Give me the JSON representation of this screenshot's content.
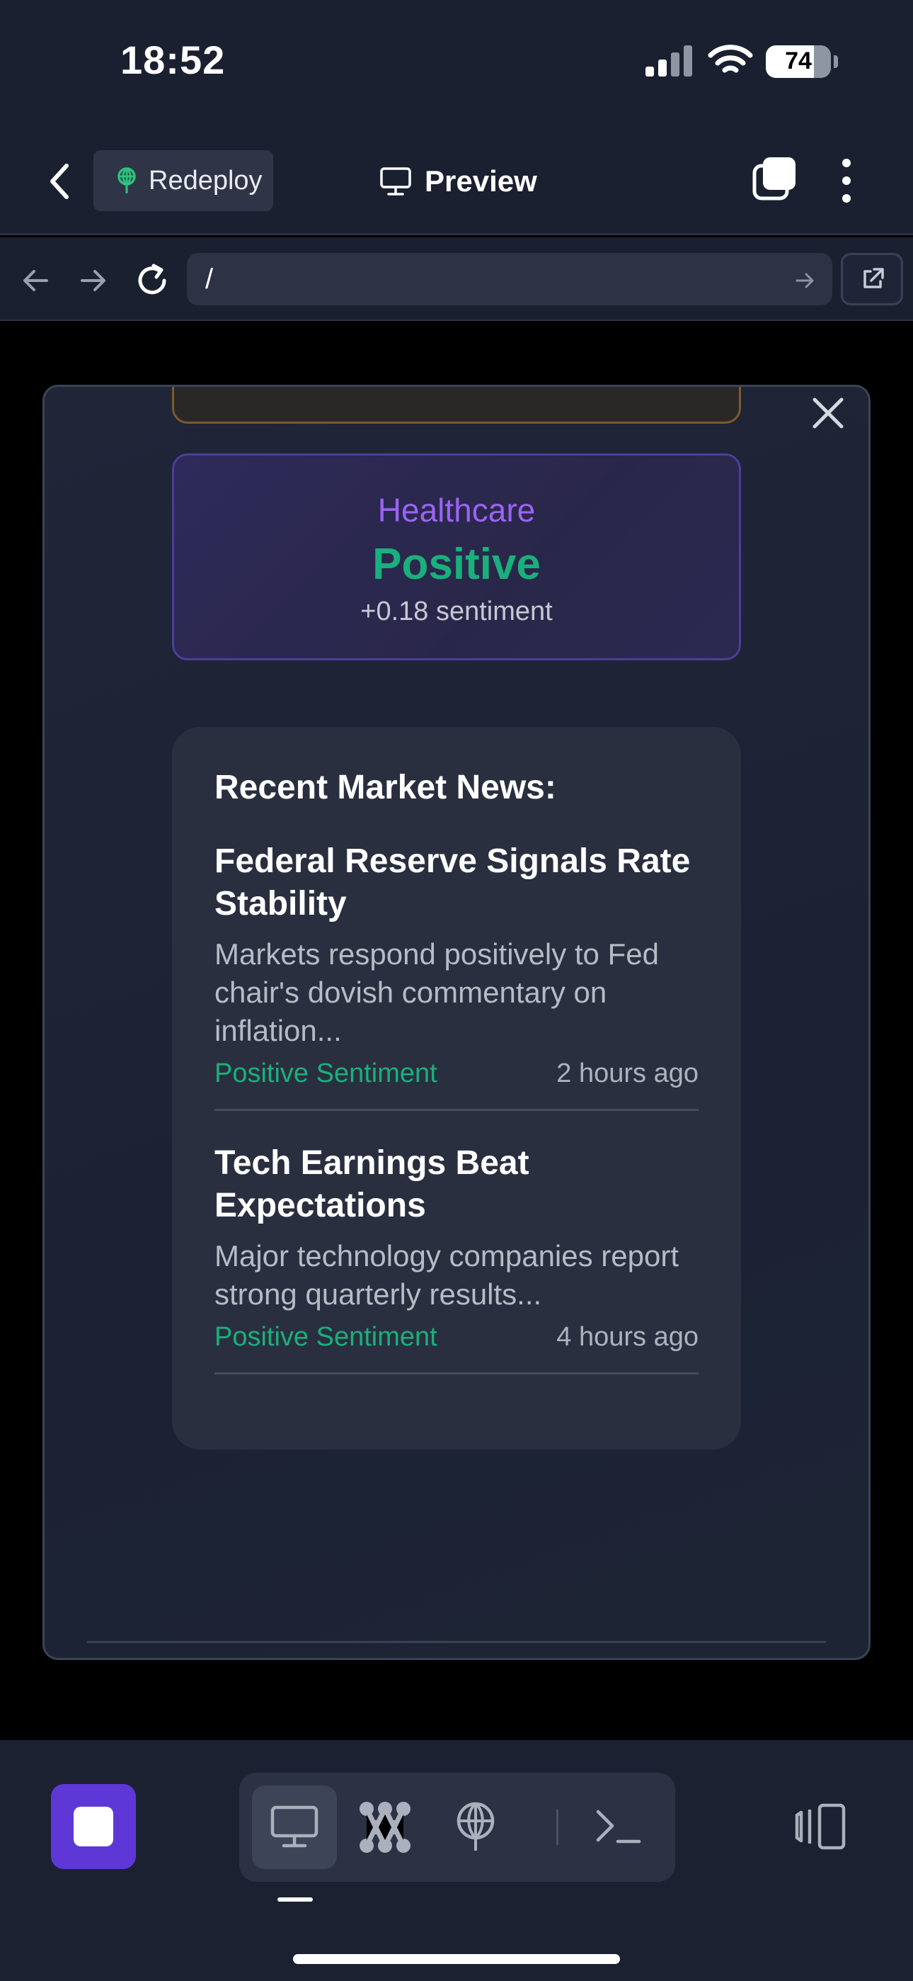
{
  "status_bar": {
    "time": "18:52",
    "battery": "74",
    "battery_level": 0.74
  },
  "header": {
    "redeploy_label": "Redeploy",
    "title": "Preview"
  },
  "url_bar": {
    "value": "/"
  },
  "modal": {
    "sector": {
      "name": "Healthcare",
      "sentiment": "Positive",
      "score": "+0.18 sentiment"
    },
    "news": {
      "heading": "Recent Market News:",
      "items": [
        {
          "title": "Federal Reserve Signals Rate Stability",
          "description": "Markets respond positively to Fed chair's dovish commentary on inflation...",
          "sentiment": "Positive Sentiment",
          "time": "2 hours ago"
        },
        {
          "title": "Tech Earnings Beat Expectations",
          "description": "Major technology companies report strong quarterly results...",
          "sentiment": "Positive Sentiment",
          "time": "4 hours ago"
        }
      ]
    }
  },
  "colors": {
    "accent_purple": "#5d38d6",
    "sector_name": "#9b63f2",
    "positive_green": "#19b07c"
  },
  "icons": {
    "back": "chevron-left-icon",
    "redeploy": "globe-tree-icon",
    "preview": "monitor-icon",
    "tabs": "tabs-icon",
    "more": "more-vertical-icon",
    "nav_back": "arrow-left-icon",
    "nav_forward": "arrow-right-icon",
    "reload": "reload-icon",
    "url_go": "arrow-right-icon",
    "open_external": "external-link-icon",
    "close": "close-icon",
    "stop": "stop-icon",
    "toolbar": [
      "monitor-icon",
      "workflow-icon",
      "deploy-icon",
      "terminal-icon"
    ],
    "device": "device-frame-icon"
  }
}
